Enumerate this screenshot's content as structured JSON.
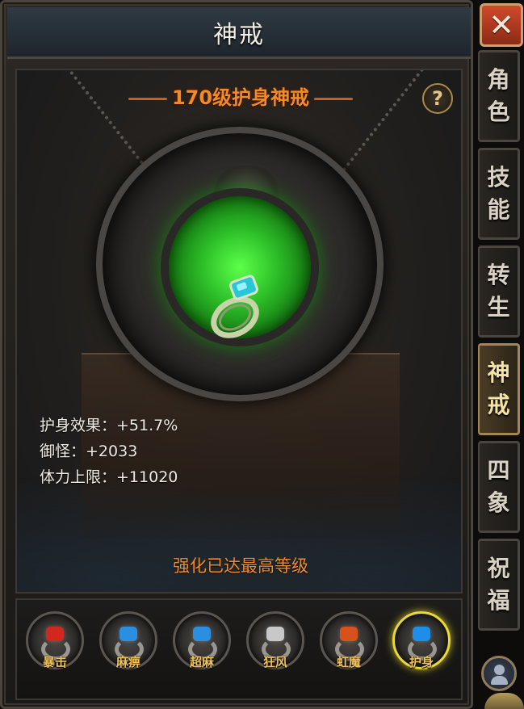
{
  "window": {
    "title": "神戒"
  },
  "ring": {
    "title": "170级护身神戒",
    "help_symbol": "?",
    "stats": [
      {
        "label": "护身效果：",
        "value": "+51.7%"
      },
      {
        "label": "御怪：",
        "value": "+2033"
      },
      {
        "label": "体力上限：",
        "value": "+11020"
      }
    ],
    "status": "强化已达最高等级"
  },
  "slots": [
    {
      "label": "暴击",
      "gem_color": "#d0281e"
    },
    {
      "label": "麻痹",
      "gem_color": "#2a8fe0"
    },
    {
      "label": "超麻",
      "gem_color": "#2a8fe0"
    },
    {
      "label": "狂风",
      "gem_color": "#c8c8c8"
    },
    {
      "label": "虹魔",
      "gem_color": "#d8501c"
    },
    {
      "label": "护身",
      "gem_color": "#1e8ee8",
      "active": true
    }
  ],
  "tabs": [
    {
      "label": "角色",
      "chars": [
        "角",
        "色"
      ]
    },
    {
      "label": "技能",
      "chars": [
        "技",
        "能"
      ]
    },
    {
      "label": "转生",
      "chars": [
        "转",
        "生"
      ]
    },
    {
      "label": "神戒",
      "chars": [
        "神",
        "戒"
      ],
      "active": true
    },
    {
      "label": "四象",
      "chars": [
        "四",
        "象"
      ]
    },
    {
      "label": "祝福",
      "chars": [
        "祝",
        "福"
      ]
    }
  ],
  "close_symbol": "✕",
  "colors": {
    "accent": "#f08a2a",
    "active_ring": "#e8d93a",
    "tab_text": "#d9d2c4"
  }
}
